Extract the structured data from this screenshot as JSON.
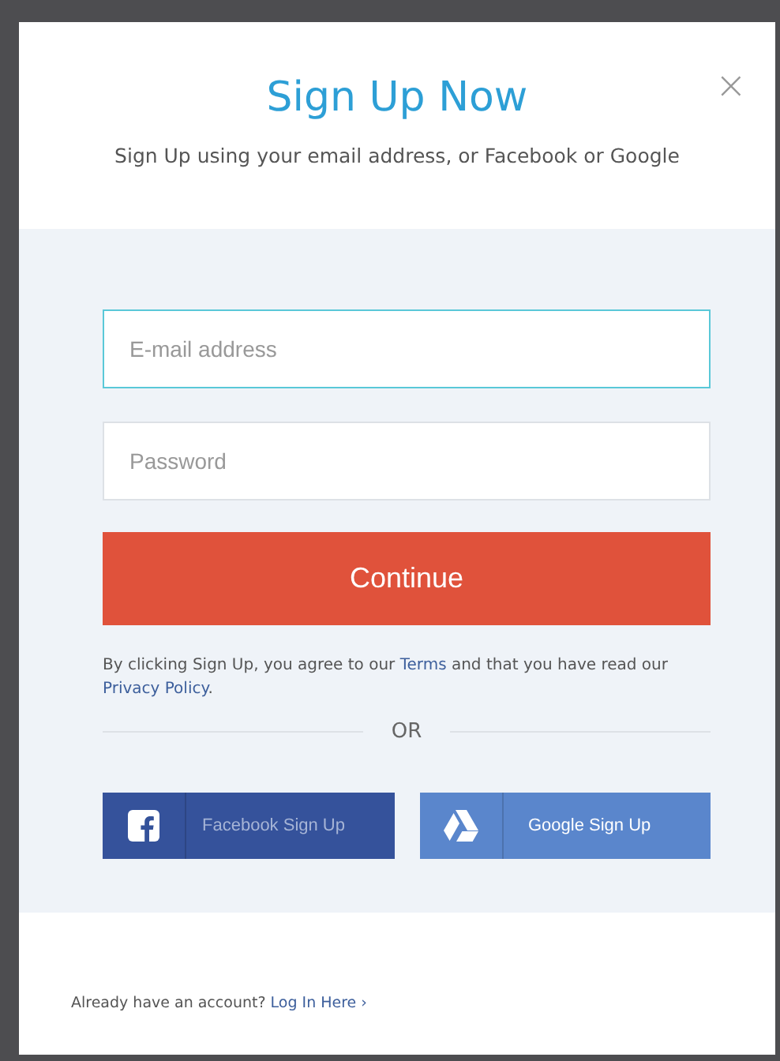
{
  "dialog": {
    "title": "Sign Up Now",
    "subtitle": "Sign Up using your email address, or Facebook or Google",
    "close": "×"
  },
  "fields": [
    {
      "placeholder": "E-mail address",
      "focused": true
    },
    {
      "placeholder": "Password",
      "focused": false
    }
  ],
  "continue_button": "Continue",
  "terms": [
    {
      "kind": "text",
      "text": "By clicking Sign Up, you agree to our "
    },
    {
      "kind": "link",
      "text": "Terms"
    },
    {
      "kind": "text",
      "text": " and that you have read our "
    },
    {
      "kind": "link",
      "text": "Privacy Policy"
    },
    {
      "kind": "text",
      "text": "."
    }
  ],
  "divider": "OR",
  "social_buttons": [
    {
      "kind": "facebook",
      "label": "Facebook Sign Up"
    },
    {
      "kind": "google",
      "label": "Google Sign Up"
    }
  ],
  "footer": [
    {
      "kind": "text",
      "text": "Already have an account?"
    },
    {
      "kind": "link",
      "text": "Log In Here ›"
    }
  ]
}
